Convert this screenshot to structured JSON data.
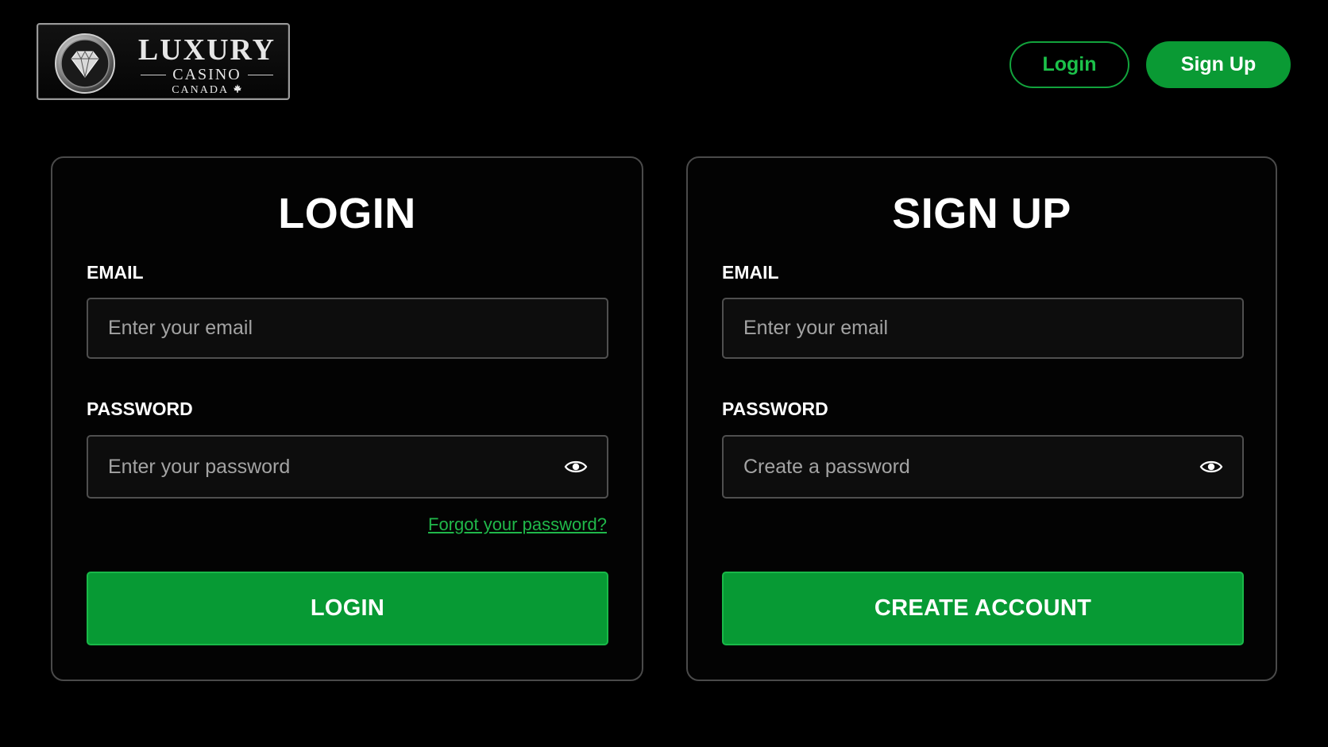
{
  "brand": {
    "logo_word": "LUXURY",
    "logo_sub": "CASINO",
    "logo_region": "CANADA",
    "emblem_icon": "diamond-icon",
    "region_icon": "maple-leaf-icon"
  },
  "header": {
    "login_label": "Login",
    "signup_label": "Sign Up"
  },
  "login_form": {
    "title": "LOGIN",
    "email_label": "EMAIL",
    "email_placeholder": "Enter your email",
    "email_value": "",
    "password_label": "PASSWORD",
    "password_placeholder": "Enter your password",
    "password_value": "",
    "show_password_icon": "eye-icon",
    "forgot_link": "Forgot your password?",
    "submit_label": "LOGIN"
  },
  "signup_form": {
    "title": "SIGN UP",
    "email_label": "EMAIL",
    "email_placeholder": "Enter your email",
    "email_value": "",
    "password_label": "PASSWORD",
    "password_placeholder": "Create a password",
    "password_value": "",
    "show_password_icon": "eye-icon",
    "submit_label": "CREATE ACCOUNT"
  },
  "colors": {
    "background": "#000000",
    "accent_green": "#079a34",
    "link_green": "#20b84a",
    "card_border": "#4a4a4a",
    "input_border": "#4f4f4f"
  }
}
